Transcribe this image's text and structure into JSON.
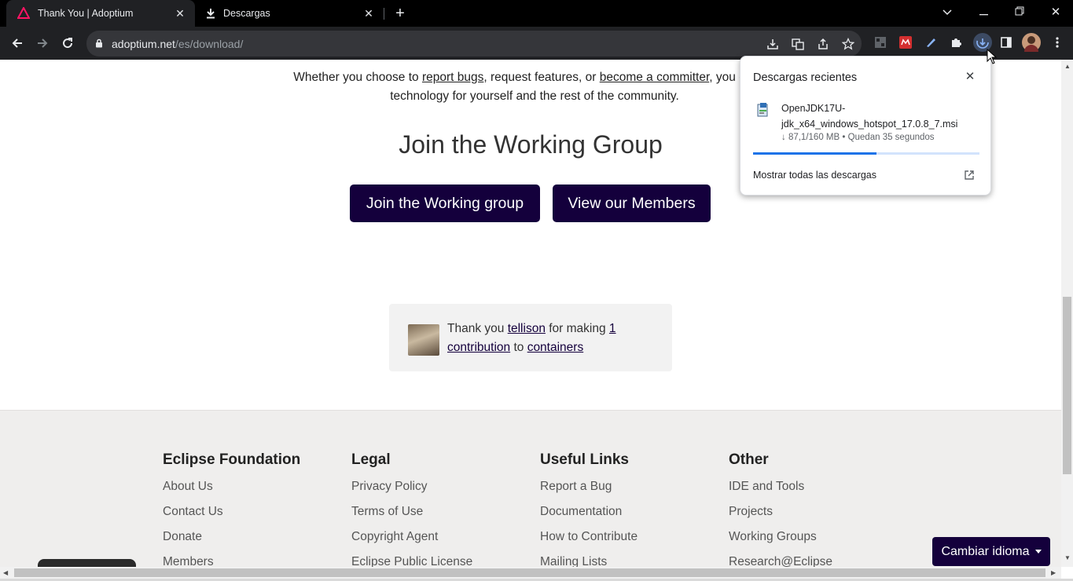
{
  "browser": {
    "tabs": [
      {
        "title": "Thank You | Adoptium",
        "active": true,
        "icon": "adoptium-logo-icon"
      },
      {
        "title": "Descargas",
        "active": false,
        "icon": "download-icon"
      }
    ],
    "url_host": "adoptium.net",
    "url_path": "/es/download/"
  },
  "page": {
    "lead_prefix": "Whether you choose to ",
    "lead_link1": "report bugs",
    "lead_middle": ", request features, or ",
    "lead_link2": "become a committer",
    "lead_suffix": ", you can he",
    "lead_line2": "technology for yourself and the rest of the community.",
    "section_title": "Join the Working Group",
    "btn_join": "Join the Working group",
    "btn_members": "View our Members",
    "thanks_prefix": "Thank you ",
    "thanks_user": "tellison",
    "thanks_mid": " for making ",
    "thanks_count": "1 contribution",
    "thanks_to": " to ",
    "thanks_repo": "containers"
  },
  "footer": {
    "columns": [
      {
        "title": "Eclipse Foundation",
        "links": [
          "About Us",
          "Contact Us",
          "Donate",
          "Members"
        ]
      },
      {
        "title": "Legal",
        "links": [
          "Privacy Policy",
          "Terms of Use",
          "Copyright Agent",
          "Eclipse Public License"
        ]
      },
      {
        "title": "Useful Links",
        "links": [
          "Report a Bug",
          "Documentation",
          "How to Contribute",
          "Mailing Lists"
        ]
      },
      {
        "title": "Other",
        "links": [
          "IDE and Tools",
          "Projects",
          "Working Groups",
          "Research@Eclipse"
        ]
      }
    ],
    "lang_button": "Cambiar idioma"
  },
  "downloads_popup": {
    "title": "Descargas recientes",
    "file_line1": "OpenJDK17U-",
    "file_line2": "jdk_x64_windows_hotspot_17.0.8_7.msi",
    "status": "↓ 87,1/160 MB • Quedan 35 segundos",
    "progress": 0.544,
    "show_all": "Mostrar todas las descargas"
  },
  "colors": {
    "brand": "#14003c",
    "progress": "#1a73e8"
  }
}
